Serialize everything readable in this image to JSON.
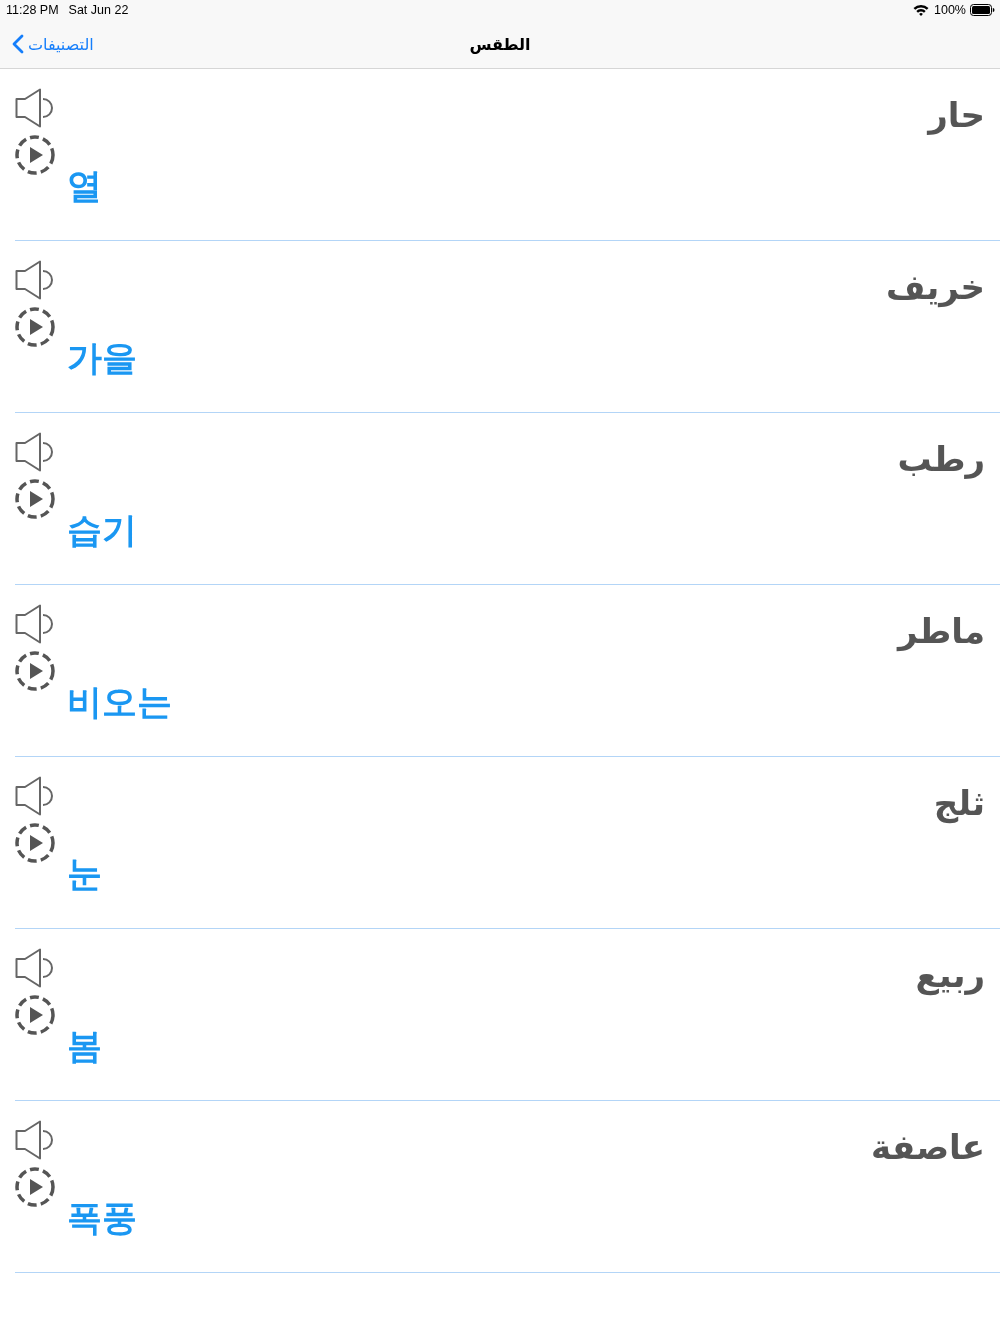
{
  "status_bar": {
    "time": "11:28 PM",
    "date": "Sat Jun 22",
    "battery": "100%"
  },
  "nav_bar": {
    "back": {
      "label": "التصنيفات"
    },
    "title": "الطقس"
  },
  "words": [
    {
      "arabic": "حار",
      "korean": "열"
    },
    {
      "arabic": "خريف",
      "korean": "가을"
    },
    {
      "arabic": "رطب",
      "korean": "습기"
    },
    {
      "arabic": "ماطر",
      "korean": "비오는"
    },
    {
      "arabic": "ثلج",
      "korean": "눈"
    },
    {
      "arabic": "ربيع",
      "korean": "봄"
    },
    {
      "arabic": "عاصفة",
      "korean": "폭풍"
    }
  ]
}
